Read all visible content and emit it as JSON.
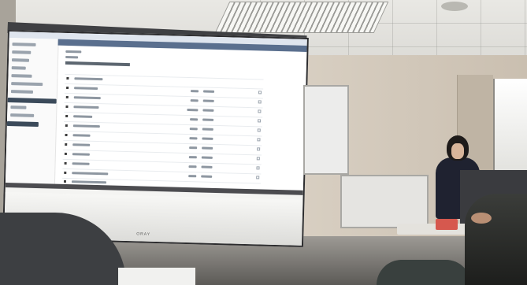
{
  "scene": {
    "screen_brand": "ORAY"
  },
  "colors": {
    "wall": "#cfc8bd",
    "screen": "#f4f4f2",
    "projected_accent": "#5a6f8e"
  }
}
